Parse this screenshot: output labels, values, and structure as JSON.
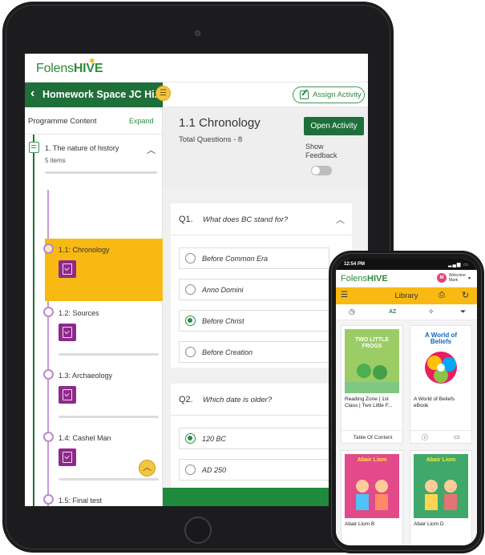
{
  "tablet": {
    "brand": {
      "folens": "Folens",
      "hive": "HIVE"
    },
    "homework_title": "Homework Space JC Hi...",
    "assign_label": "Assign Activity",
    "sidebar": {
      "heading": "Programme Content",
      "expand": "Expand",
      "unit": {
        "title": "1. The nature of history",
        "items": "5 items"
      },
      "lessons": [
        {
          "label": "1.1: Chronology",
          "active": true
        },
        {
          "label": "1.2: Sources",
          "active": false
        },
        {
          "label": "1.3: Archaeology",
          "active": false
        },
        {
          "label": "1.4: Cashel Man",
          "active": false
        },
        {
          "label": "1.5: Final test",
          "active": false
        }
      ]
    },
    "main": {
      "title": "1.1 Chronology",
      "total_questions": "Total Questions - 8",
      "open_activity": "Open Activity",
      "show_feedback": "Show Feedback",
      "questions": [
        {
          "num": "Q1.",
          "text": "What does BC stand for?",
          "options": [
            {
              "text": "Before Common Era",
              "selected": false
            },
            {
              "text": "Anno Domini",
              "selected": false
            },
            {
              "text": "Before Christ",
              "selected": true
            },
            {
              "text": "Before Creation",
              "selected": false
            }
          ]
        },
        {
          "num": "Q2.",
          "text": "Which date is older?",
          "options": [
            {
              "text": "120 BC",
              "selected": true
            },
            {
              "text": "AD 250",
              "selected": false
            }
          ]
        }
      ]
    }
  },
  "phone": {
    "time": "12:54 PM",
    "brand": {
      "folens": "Folens",
      "hive": "HIVE"
    },
    "avatar": "M",
    "welcome": "Welcome",
    "user": "Mark",
    "library_title": "Library",
    "filter_az": "AZ",
    "books": [
      {
        "cover_text": "TWO LITTLE FROGS",
        "title": "Reading Zone | 1st Class | Two Little F...",
        "action": "Table Of Content",
        "cover_color": "#8bc34a"
      },
      {
        "cover_text": "A World of Beliefs",
        "title": "A World of Beliefs eBook",
        "action": "",
        "cover_color": "#ffffff"
      },
      {
        "cover_text": "Abair Liom",
        "title": "Abair Liom B",
        "action": "",
        "cover_color": "#e24a8a"
      },
      {
        "cover_text": "Abair Liom",
        "title": "Abair Liom D",
        "action": "",
        "cover_color": "#3fa86a"
      }
    ]
  },
  "colors": {
    "brand_green": "#1f6f3a",
    "accent_yellow": "#f8b913",
    "badge_purple": "#8e2a8a"
  }
}
